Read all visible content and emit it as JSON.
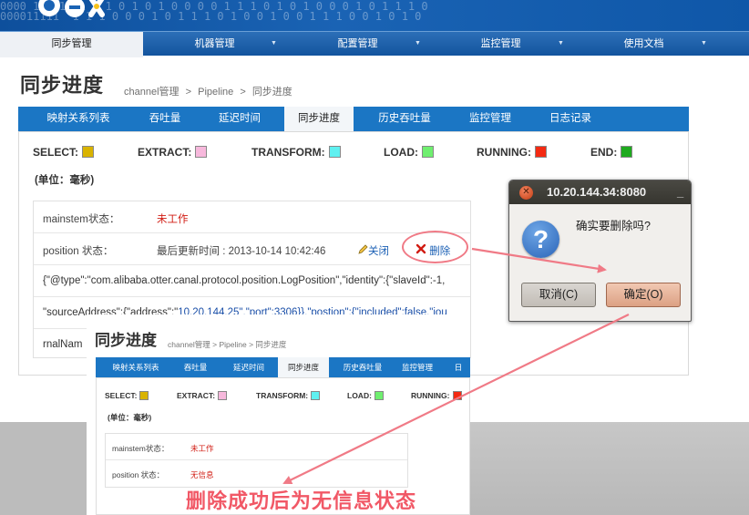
{
  "banner": {
    "digits": "0000 1 1 1  1 1 1 0 1 0 1 0 0 0 0 1 1 1 0 1 0 1 0 0 0 1 0 1 1 1 0 0 1 0 1\n000011111  1 1 1 0 0 0 1 0 1 1 1 0 1 0 0 1 0 0 1 1 1 0 0 1 0 1 0 1 0 0 1 0 1 0 1"
  },
  "topnav": {
    "items": [
      {
        "label": "同步管理"
      },
      {
        "label": "机器管理"
      },
      {
        "label": "配置管理"
      },
      {
        "label": "监控管理"
      },
      {
        "label": "使用文档"
      }
    ],
    "arrow": "▼"
  },
  "page": {
    "title": "同步进度",
    "breadcrumb": [
      "channel管理",
      ">",
      "Pipeline",
      ">",
      "同步进度"
    ]
  },
  "subtabs": [
    "映射关系列表",
    "吞吐量",
    "延迟时间",
    "同步进度",
    "历史吞吐量",
    "监控管理",
    "日志记录"
  ],
  "legend": [
    {
      "label": "SELECT:",
      "color": "#d9b300"
    },
    {
      "label": "EXTRACT:",
      "color": "#f7b8dc"
    },
    {
      "label": "TRANSFORM:",
      "color": "#5ff0f0"
    },
    {
      "label": "LOAD:",
      "color": "#6fef6f"
    },
    {
      "label": "RUNNING:",
      "color": "#f42a12"
    },
    {
      "label": "END:",
      "color": "#1eaa1e"
    }
  ],
  "unit": "(单位：毫秒)",
  "mainstem": {
    "label": "mainstem状态：",
    "value": "未工作"
  },
  "position": {
    "label": "position 状态：",
    "updated": "最后更新时间 : 2013-10-14 10:42:46",
    "close_label": "关闭",
    "delete_label": "删除"
  },
  "json_lines": {
    "line1": "{\"@type\":\"com.alibaba.otter.canal.protocol.position.LogPosition\",\"identity\":{\"slaveId\":-1,",
    "line2_a": "\"sourceAddress\":{\"address\":\"",
    "line2_b": "10.20.144.25\",\"port\":3306}},\"postion\":{\"included\":false,\"jou",
    "line3": "rnalNam"
  },
  "dialog": {
    "title": "10.20.144.34:8080",
    "minimize": "_",
    "message": "确实要删除吗?",
    "cancel_label": "取消(C)",
    "ok_label": "确定(O)"
  },
  "overlay": {
    "title": "同步进度",
    "breadcrumb": "channel管理 > Pipeline > 同步进度",
    "tabs": [
      "映射关系列表",
      "吞吐量",
      "延迟时间",
      "同步进度",
      "历史吞吐量",
      "监控管理",
      "日"
    ],
    "legend": [
      "SELECT:",
      "EXTRACT:",
      "TRANSFORM:",
      "LOAD:",
      "RUNNING:"
    ],
    "unit": "(单位：毫秒)",
    "mainstem_label": "mainstem状态：",
    "mainstem_value": "未工作",
    "position_label": "position 状态：",
    "position_value": "无信息"
  },
  "caption": "删除成功后为无信息状态",
  "colors": {
    "accent_red": "#f15866",
    "nav_blue": "#1b76c4"
  }
}
